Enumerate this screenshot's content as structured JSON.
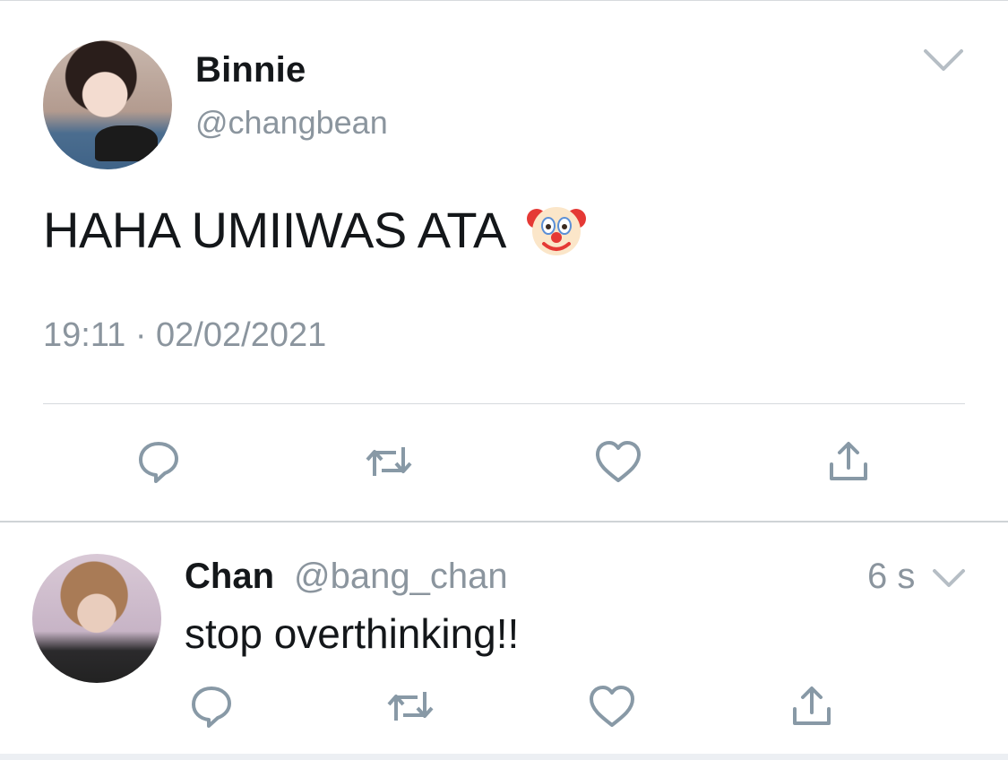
{
  "main_tweet": {
    "display_name": "Binnie",
    "handle": "@changbean",
    "text": "HAHA UMIIWAS ATA",
    "emoji_icon": "clown-face-icon",
    "timestamp": "19:11 · 02/02/2021",
    "actions": [
      "reply-icon",
      "retweet-icon",
      "like-icon",
      "share-icon"
    ]
  },
  "reply": {
    "display_name": "Chan",
    "handle": "@bang_chan",
    "time": "6 s",
    "text": "stop overthinking!!",
    "actions": [
      "reply-icon",
      "retweet-icon",
      "like-icon",
      "share-icon"
    ]
  },
  "colors": {
    "text": "#14171a",
    "secondary": "#8b959e",
    "icon": "#8899a6",
    "divider": "#d6dadd"
  }
}
